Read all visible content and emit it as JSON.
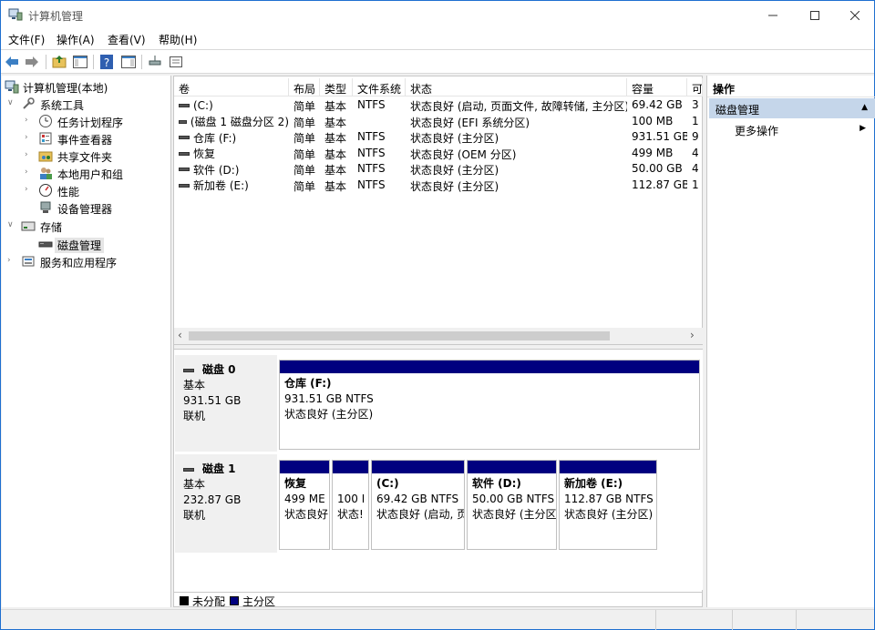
{
  "window": {
    "title": "计算机管理"
  },
  "menu": [
    "文件(F)",
    "操作(A)",
    "查看(V)",
    "帮助(H)"
  ],
  "tree": {
    "root": "计算机管理(本地)",
    "items": [
      {
        "label": "系统工具",
        "icon": "tools-icon"
      },
      {
        "label": "任务计划程序",
        "icon": "clock-icon"
      },
      {
        "label": "事件查看器",
        "icon": "event-viewer-icon"
      },
      {
        "label": "共享文件夹",
        "icon": "shared-folder-icon"
      },
      {
        "label": "本地用户和组",
        "icon": "users-icon"
      },
      {
        "label": "性能",
        "icon": "performance-icon"
      },
      {
        "label": "设备管理器",
        "icon": "device-manager-icon"
      },
      {
        "label": "存储",
        "icon": "storage-icon"
      },
      {
        "label": "磁盘管理",
        "icon": "disk-icon"
      },
      {
        "label": "服务和应用程序",
        "icon": "services-icon"
      }
    ]
  },
  "volume_list": {
    "columns": [
      "卷",
      "布局",
      "类型",
      "文件系统",
      "状态",
      "容量",
      "可"
    ],
    "rows": [
      {
        "vol": "(C:)",
        "layout": "简单",
        "type": "基本",
        "fs": "NTFS",
        "status": "状态良好 (启动, 页面文件, 故障转储, 主分区)",
        "cap": "69.42 GB",
        "free": "3"
      },
      {
        "vol": "(磁盘 1 磁盘分区 2)",
        "layout": "简单",
        "type": "基本",
        "fs": "",
        "status": "状态良好 (EFI 系统分区)",
        "cap": "100 MB",
        "free": "1"
      },
      {
        "vol": "仓库 (F:)",
        "layout": "简单",
        "type": "基本",
        "fs": "NTFS",
        "status": "状态良好 (主分区)",
        "cap": "931.51 GB",
        "free": "9"
      },
      {
        "vol": "恢复",
        "layout": "简单",
        "type": "基本",
        "fs": "NTFS",
        "status": "状态良好 (OEM 分区)",
        "cap": "499 MB",
        "free": "4"
      },
      {
        "vol": "软件 (D:)",
        "layout": "简单",
        "type": "基本",
        "fs": "NTFS",
        "status": "状态良好 (主分区)",
        "cap": "50.00 GB",
        "free": "4"
      },
      {
        "vol": "新加卷 (E:)",
        "layout": "简单",
        "type": "基本",
        "fs": "NTFS",
        "status": "状态良好 (主分区)",
        "cap": "112.87 GB",
        "free": "1"
      }
    ]
  },
  "disks": [
    {
      "name": "磁盘 0",
      "type": "基本",
      "size": "931.51 GB",
      "state": "联机",
      "partitions": [
        {
          "name": "仓库 (F:)",
          "size": "931.51 GB NTFS",
          "status": "状态良好 (主分区)"
        }
      ]
    },
    {
      "name": "磁盘 1",
      "type": "基本",
      "size": "232.87 GB",
      "state": "联机",
      "partitions": [
        {
          "name": "恢复",
          "size": "499 ME",
          "status": "状态良好"
        },
        {
          "name": "",
          "size": "100 I",
          "status": "状态!"
        },
        {
          "name": "(C:)",
          "size": "69.42 GB NTFS",
          "status": "状态良好 (启动, 页"
        },
        {
          "name": "软件 (D:)",
          "size": "50.00 GB NTFS",
          "status": "状态良好 (主分区"
        },
        {
          "name": "新加卷 (E:)",
          "size": "112.87 GB NTFS",
          "status": "状态良好 (主分区)"
        }
      ]
    }
  ],
  "legend": [
    {
      "label": "未分配",
      "color": "#000000"
    },
    {
      "label": "主分区",
      "color": "#00007f"
    }
  ],
  "actions": {
    "header": "操作",
    "selected": "磁盘管理",
    "more": "更多操作"
  },
  "colors": {
    "partition_bar": "#00007f",
    "selection": "#c5d6ea",
    "window_border": "#1e6fd0"
  }
}
